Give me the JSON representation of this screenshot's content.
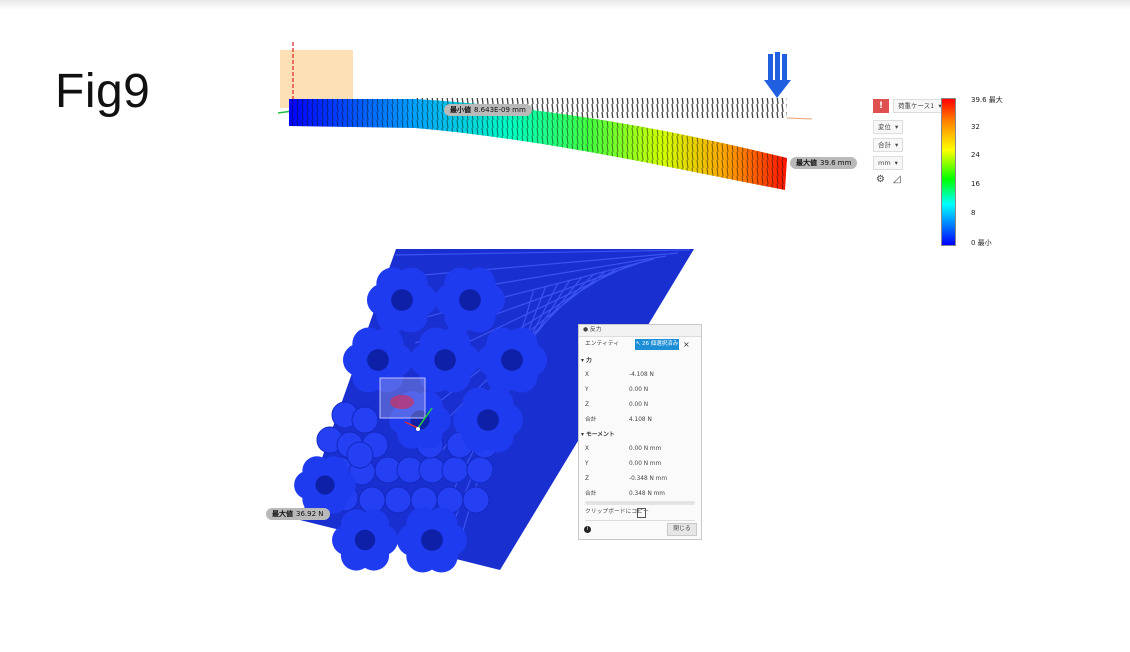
{
  "figure_title": "Fig9",
  "beam": {
    "min_label": "最小値",
    "min_value": "8.643E-09 mm",
    "max_label": "最大値",
    "max_value": "39.6 mm"
  },
  "legend": {
    "case_dropdown": "荷重ケース1",
    "result_type": "変位",
    "component": "合計",
    "unit": "mm",
    "ticks": [
      "39.6 最大",
      "32",
      "24",
      "16",
      "8",
      "0 最小"
    ],
    "colors": {
      "max": "#ff0000",
      "mid": "#00ff00",
      "min": "#0000ff"
    }
  },
  "pile": {
    "max_label": "最大値",
    "max_value": "36.92 N"
  },
  "reaction_dialog": {
    "title": "反力",
    "entity_label": "エンティティ",
    "entity_button": "26 個選択済み",
    "force_section": "力",
    "force": [
      {
        "label": "X",
        "value": "-4.108 N"
      },
      {
        "label": "Y",
        "value": "0.00 N"
      },
      {
        "label": "Z",
        "value": "0.00 N"
      },
      {
        "label": "合計",
        "value": "4.108 N"
      }
    ],
    "moment_section": "モーメント",
    "moment": [
      {
        "label": "X",
        "value": "0.00 N mm"
      },
      {
        "label": "Y",
        "value": "0.00 N mm"
      },
      {
        "label": "Z",
        "value": "-0.348 N mm"
      },
      {
        "label": "合計",
        "value": "0.348 N mm"
      }
    ],
    "copy_label": "クリップボードにコピー",
    "close_label": "閉じる"
  }
}
